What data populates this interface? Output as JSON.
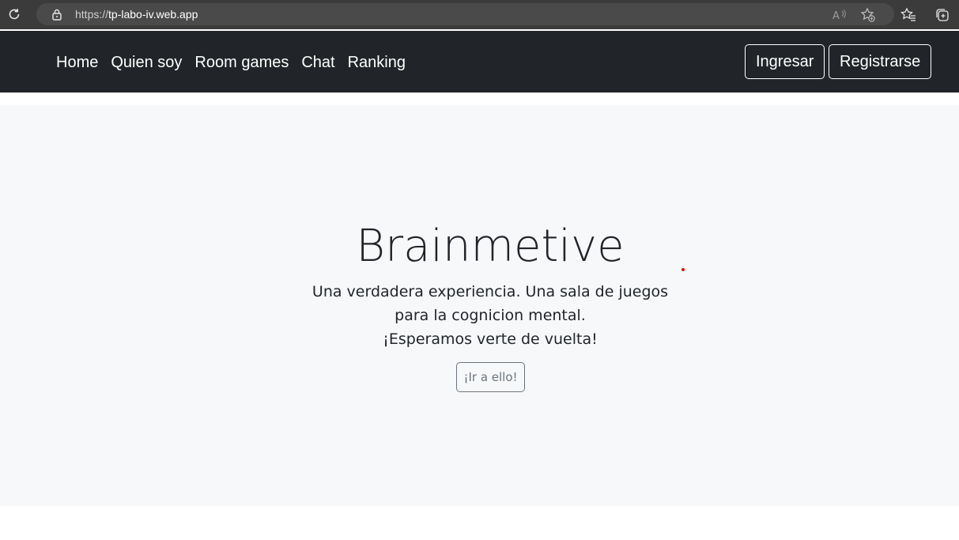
{
  "browser": {
    "url_scheme": "https://",
    "url_host": "tp-labo-iv.web.app"
  },
  "navbar": {
    "links": [
      "Home",
      "Quien soy",
      "Room games",
      "Chat",
      "Ranking"
    ],
    "login_label": "Ingresar",
    "register_label": "Registrarse"
  },
  "hero": {
    "title": "Brainmetive",
    "lines": [
      "Una verdadera experiencia. Una sala de juegos",
      "para la cognicion mental.",
      "¡Esperamos verte de vuelta!"
    ],
    "cta_label": "¡Ir a ello!"
  },
  "colors": {
    "navbar_bg": "#212529",
    "hero_bg": "#f7f8fa",
    "text": "#212529",
    "secondary": "#6c757d"
  },
  "icons": [
    "reload-icon",
    "lock-icon",
    "read-aloud-icon",
    "add-favorite-icon",
    "favorites-icon",
    "collections-icon"
  ]
}
